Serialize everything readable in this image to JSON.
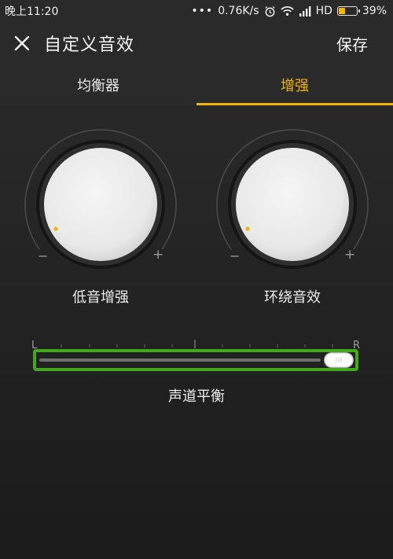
{
  "status_bar": {
    "time": "晚上11:20",
    "network_speed": "0.76K/s",
    "network_label": "HD",
    "battery_percent": "39%",
    "battery_level": 0.39,
    "icons": [
      "dots-icon",
      "alarm-icon",
      "wifi-icon",
      "signal-icon",
      "battery-icon"
    ]
  },
  "app_bar": {
    "title": "自定义音效",
    "save_label": "保存",
    "close_icon": "close-icon"
  },
  "tabs": [
    {
      "label": "均衡器",
      "active": false
    },
    {
      "label": "增强",
      "active": true
    }
  ],
  "knobs": [
    {
      "label": "低音增强",
      "minus": "−",
      "plus": "+",
      "level": 0
    },
    {
      "label": "环绕音效",
      "minus": "−",
      "plus": "+",
      "level": 0
    }
  ],
  "balance": {
    "label": "声道平衡",
    "left_mark": "L",
    "right_mark": "R",
    "value": 1.0
  },
  "colors": {
    "accent": "#f0b400",
    "slider_border": "#43a81c",
    "background": "#262626"
  }
}
